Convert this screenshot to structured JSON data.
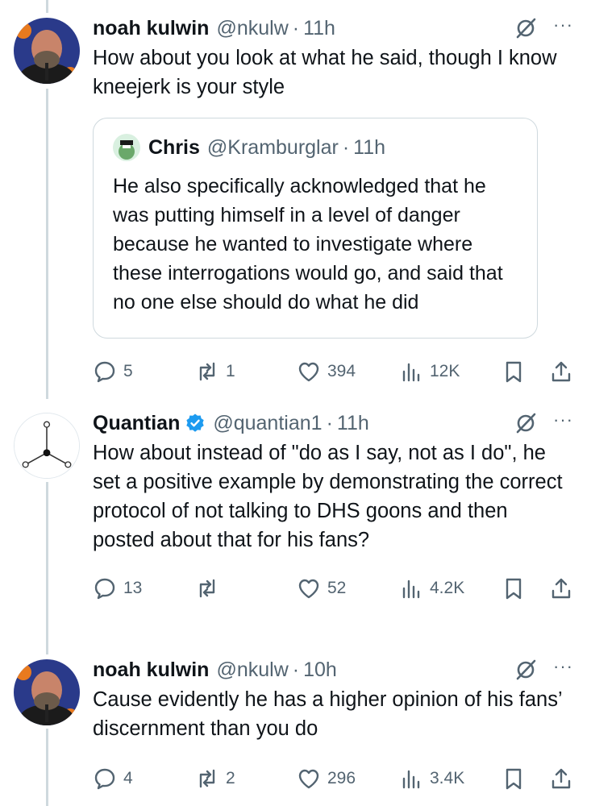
{
  "tweets": [
    {
      "name": "noah kulwin",
      "handle": "@nkulw",
      "sep": "·",
      "time": "11h",
      "verified": false,
      "text": "How about you look at what he said, though I know kneejerk is your style",
      "quote": {
        "name": "Chris",
        "handle": "@Kramburglar",
        "sep": "·",
        "time": "11h",
        "text": "He also specifically acknowledged that he was putting himself in a level of danger because he wanted to investigate where these interrogations would go, and said that no one else should do what he did"
      },
      "replies": "5",
      "reposts": "1",
      "likes": "394",
      "views": "12K"
    },
    {
      "name": "Quantian",
      "handle": "@quantian1",
      "sep": "·",
      "time": "11h",
      "verified": true,
      "text": "How about instead of \"do as I say, not as I do\", he set a positive example by demonstrating the correct protocol of not talking to DHS goons and then posted about that for his fans?",
      "replies": "13",
      "reposts": "",
      "likes": "52",
      "views": "4.2K"
    },
    {
      "name": "noah kulwin",
      "handle": "@nkulw",
      "sep": "·",
      "time": "10h",
      "verified": false,
      "text": "Cause evidently he has a higher opinion of his fans’ discernment than you do",
      "replies": "4",
      "reposts": "2",
      "likes": "296",
      "views": "3.4K"
    }
  ],
  "more_glyph": "···",
  "colors": {
    "text": "#0f1419",
    "secondary": "#536471",
    "border": "#cfd9de",
    "verified": "#1d9bf0"
  },
  "icons": [
    "reply-icon",
    "repost-icon",
    "like-icon",
    "views-icon",
    "bookmark-icon",
    "share-icon",
    "grok-icon",
    "verified-badge-icon"
  ]
}
